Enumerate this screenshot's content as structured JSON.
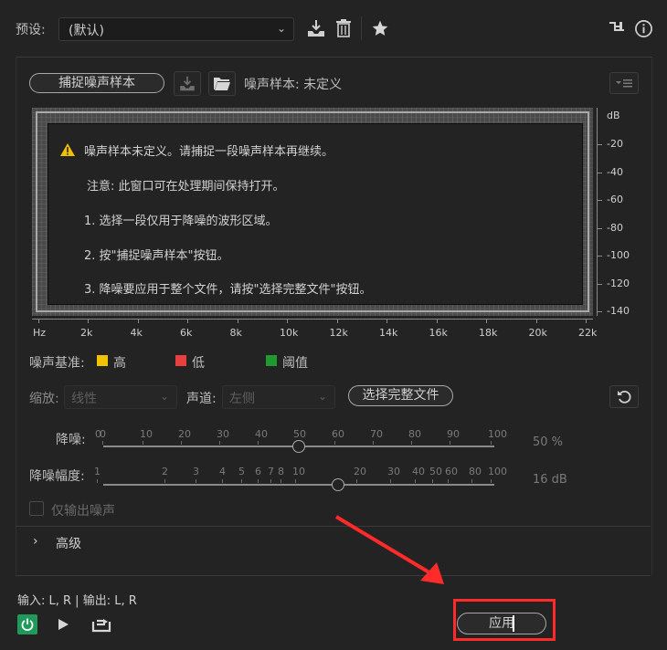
{
  "preset": {
    "label": "预设:",
    "selected": "(默认)"
  },
  "capture": {
    "button_label": "捕捉噪声样本",
    "status": "噪声样本: 未定义"
  },
  "notice": {
    "line1": "噪声样本未定义。请捕捉一段噪声样本再继续。",
    "line2": "注意: 此窗口可在处理期间保持打开。",
    "line3": "1. 选择一段仅用于降噪的波形区域。",
    "line4": "2. 按\"捕捉噪声样本\"按钮。",
    "line5": "3. 降噪要应用于整个文件，请按\"选择完整文件\"按钮。"
  },
  "graph": {
    "y_unit": "dB",
    "y_ticks": [
      "-20",
      "-40",
      "-60",
      "-80",
      "-100",
      "-120",
      "-140"
    ],
    "x_ticks": [
      "Hz",
      "2k",
      "4k",
      "6k",
      "8k",
      "10k",
      "12k",
      "14k",
      "16k",
      "18k",
      "20k",
      "22k"
    ]
  },
  "legend": {
    "label": "噪声基准:",
    "items": [
      {
        "label": "高",
        "color": "#f2c200"
      },
      {
        "label": "低",
        "color": "#e84040"
      },
      {
        "label": "阈值",
        "color": "#1f9a2e"
      }
    ]
  },
  "scale": {
    "label": "缩放:",
    "value": "线性"
  },
  "channel": {
    "label": "声道:",
    "value": "左侧"
  },
  "select_full_file": "选择完整文件",
  "reduction": {
    "label": "降噪:",
    "ticks": [
      "0",
      "0",
      "10",
      "20",
      "30",
      "40",
      "50",
      "60",
      "70",
      "80",
      "90",
      "100"
    ],
    "value_text": "50 %",
    "value": 50
  },
  "reduce_by": {
    "label": "降噪幅度:",
    "ticks": [
      "1",
      "2",
      "3",
      "4",
      "5",
      "6",
      "7",
      "8",
      "10",
      "20",
      "30",
      "40",
      "50",
      "60",
      "80",
      "100"
    ],
    "value_text": "16 dB"
  },
  "output_noise_only": "仅输出噪声",
  "advanced": {
    "label": "高级"
  },
  "io": "输入: L, R | 输出: L, R",
  "apply": "应用",
  "accent_colors": {
    "power": "#1f9a5a",
    "annotation": "#ff2a2a"
  }
}
